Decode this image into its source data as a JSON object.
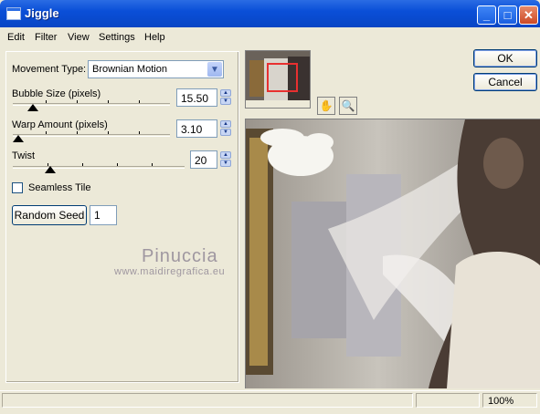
{
  "window": {
    "title": "Jiggle"
  },
  "menu": [
    "Edit",
    "Filter",
    "View",
    "Settings",
    "Help"
  ],
  "controls": {
    "movement_type_label": "Movement Type:",
    "movement_type_value": "Brownian Motion",
    "bubble_size_label": "Bubble Size (pixels)",
    "bubble_size_value": "15.50",
    "warp_amount_label": "Warp Amount (pixels)",
    "warp_amount_value": "3.10",
    "twist_label": "Twist",
    "twist_value": "20",
    "seamless_tile_label": "Seamless Tile",
    "seamless_tile_checked": false,
    "random_seed_button": "Random Seed",
    "random_seed_value": "1"
  },
  "buttons": {
    "ok": "OK",
    "cancel": "Cancel"
  },
  "watermark": {
    "name": "Pinuccia",
    "url": "www.maidiregrafica.eu"
  },
  "status": {
    "zoom": "100%"
  }
}
